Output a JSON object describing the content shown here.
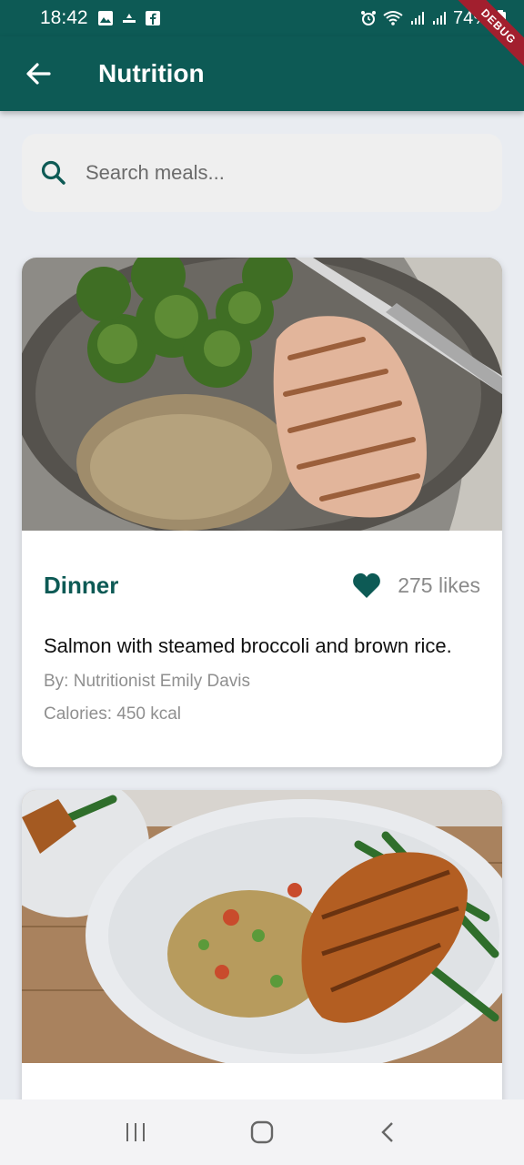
{
  "status_bar": {
    "time": "18:42",
    "battery": "74%",
    "debug_label": "DEBUG"
  },
  "app_bar": {
    "title": "Nutrition"
  },
  "search": {
    "placeholder": "Search meals..."
  },
  "meals": [
    {
      "type": "Dinner",
      "likes": "275 likes",
      "description": "Salmon with steamed broccoli and brown rice.",
      "author": "By: Nutritionist Emily Davis",
      "calories": "Calories: 450 kcal"
    }
  ],
  "colors": {
    "primary": "#0d5a55",
    "background": "#e9ecf1"
  }
}
